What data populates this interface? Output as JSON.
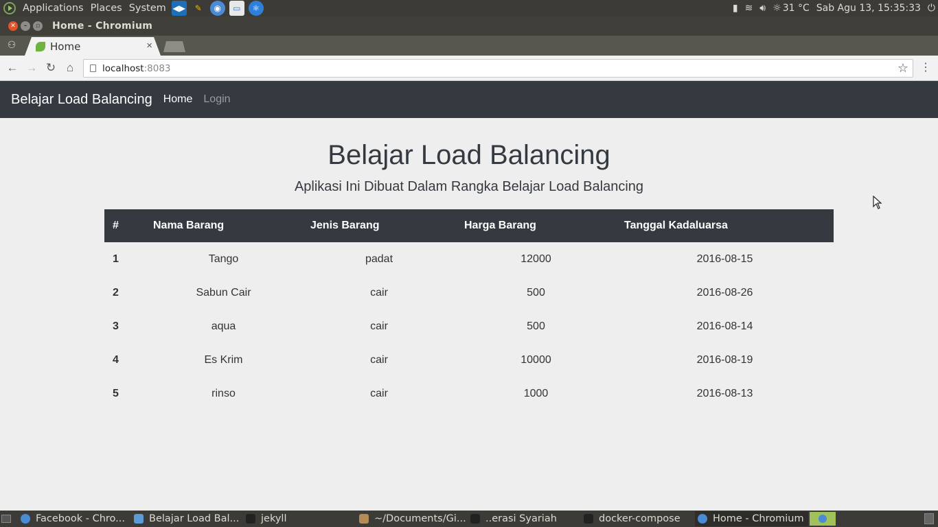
{
  "system_panel": {
    "menus": [
      "Applications",
      "Places",
      "System"
    ],
    "temperature": "31 °C",
    "datetime": "Sab Agu 13, 15:35:33"
  },
  "window": {
    "title": "Home - Chromium"
  },
  "browser": {
    "tab_title": "Home",
    "tab_close": "×",
    "url_host": "localhost",
    "url_port": ":8083"
  },
  "site": {
    "brand": "Belajar Load Balancing",
    "nav": {
      "home": "Home",
      "login": "Login"
    },
    "title": "Belajar Load Balancing",
    "subtitle": "Aplikasi Ini Dibuat Dalam Rangka Belajar Load Balancing",
    "table": {
      "headers": [
        "#",
        "Nama Barang",
        "Jenis Barang",
        "Harga Barang",
        "Tanggal Kadaluarsa"
      ],
      "rows": [
        [
          "1",
          "Tango",
          "padat",
          "12000",
          "2016-08-15"
        ],
        [
          "2",
          "Sabun Cair",
          "cair",
          "500",
          "2016-08-26"
        ],
        [
          "3",
          "aqua",
          "cair",
          "500",
          "2016-08-14"
        ],
        [
          "4",
          "Es Krim",
          "cair",
          "10000",
          "2016-08-19"
        ],
        [
          "5",
          "rinso",
          "cair",
          "1000",
          "2016-08-13"
        ]
      ]
    }
  },
  "taskbar": {
    "tasks": [
      "Facebook - Chro...",
      "Belajar Load Bal...",
      "jekyll",
      "~/Documents/Gi...",
      "..erasi Syariah",
      "docker-compose",
      "Home - Chromium"
    ]
  },
  "colors": {
    "navbar": "#343a40",
    "page_bg": "#eeeeee",
    "panel": "#3c3b37"
  }
}
